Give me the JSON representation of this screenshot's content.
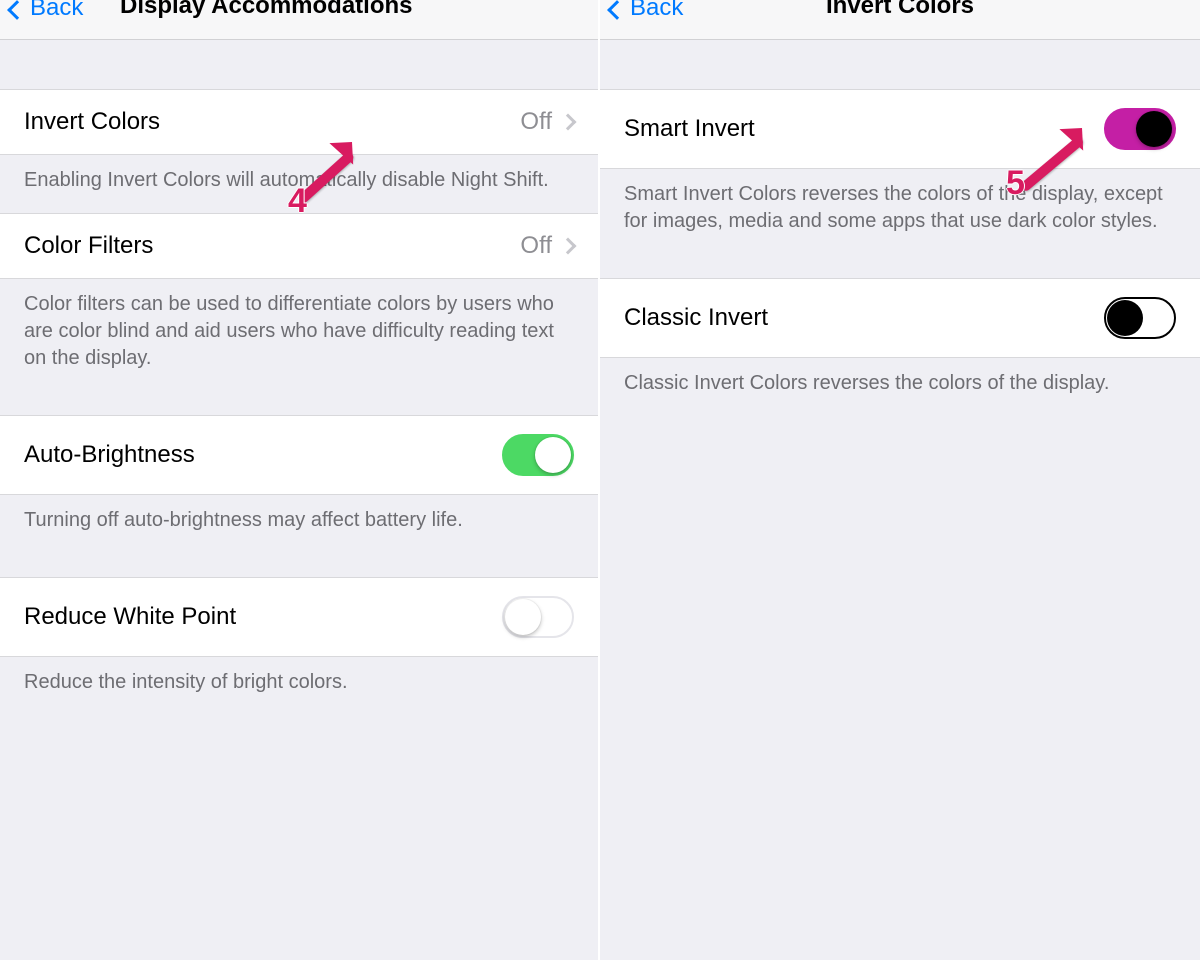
{
  "left": {
    "back": "Back",
    "title": "Display Accommodations",
    "invert": {
      "label": "Invert Colors",
      "value": "Off",
      "footer": "Enabling Invert Colors will automatically disable Night Shift."
    },
    "filters": {
      "label": "Color Filters",
      "value": "Off",
      "footer": "Color filters can be used to differentiate colors by users who are color blind and aid users who have difficulty reading text on the display."
    },
    "auto": {
      "label": "Auto-Brightness",
      "on": true,
      "footer": "Turning off auto-brightness may affect battery life."
    },
    "white": {
      "label": "Reduce White Point",
      "on": false,
      "footer": "Reduce the intensity of bright colors."
    }
  },
  "right": {
    "back": "Back",
    "title": "Invert Colors",
    "smart": {
      "label": "Smart Invert",
      "on": true,
      "footer": "Smart Invert Colors reverses the colors of the display, except for images, media and some apps that use dark color styles."
    },
    "classic": {
      "label": "Classic Invert",
      "on": false,
      "footer": "Classic Invert Colors reverses the colors of the display."
    }
  },
  "annotations": {
    "a": "4",
    "b": "5"
  },
  "colors": {
    "accent_magenta": "#c41fa5",
    "annotation": "#d81b60",
    "ios_green": "#4cd964",
    "ios_blue": "#007aff"
  }
}
